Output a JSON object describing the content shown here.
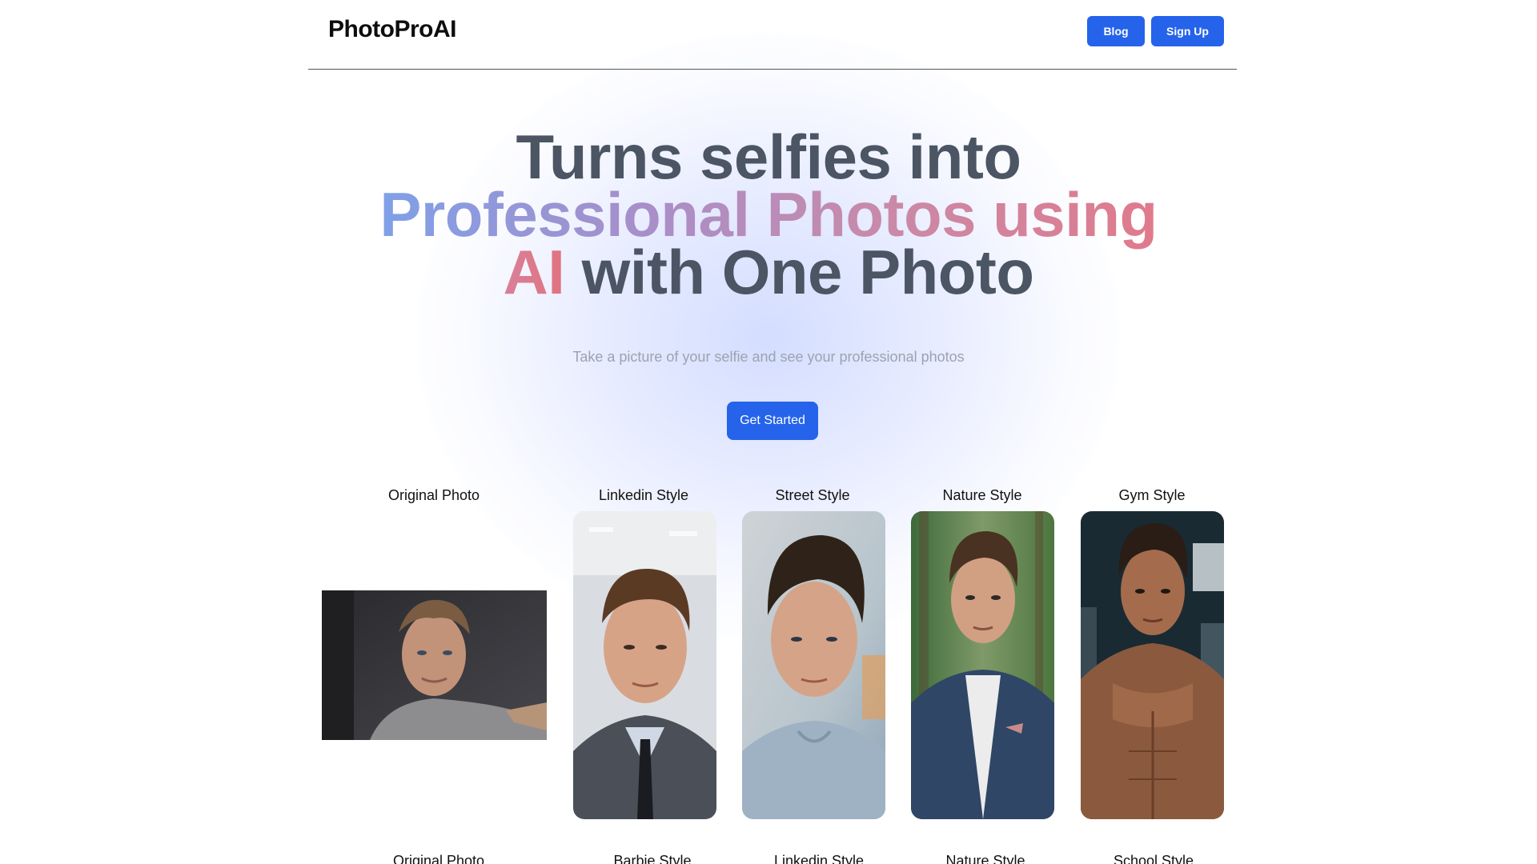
{
  "header": {
    "logo": "PhotoProAI",
    "blog_label": "Blog",
    "signup_label": "Sign Up"
  },
  "hero": {
    "line1": "Turns selfies into",
    "line2_gradient": "Professional Photos using",
    "line3_ai": "AI",
    "line3_rest": " with One Photo",
    "subtitle": "Take a picture of your selfie and see your professional photos",
    "cta_label": "Get Started"
  },
  "gallery_row1": {
    "labels": [
      "Original Photo",
      "Linkedin Style",
      "Street Style",
      "Nature Style",
      "Gym Style"
    ]
  },
  "gallery_row2": {
    "labels": [
      "Original Photo",
      "Barbie Style",
      "Linkedin Style",
      "Nature Style",
      "School Style"
    ]
  },
  "colors": {
    "accent": "#2563eb",
    "heading": "#4b5563",
    "subtitle": "#9ca3af"
  }
}
